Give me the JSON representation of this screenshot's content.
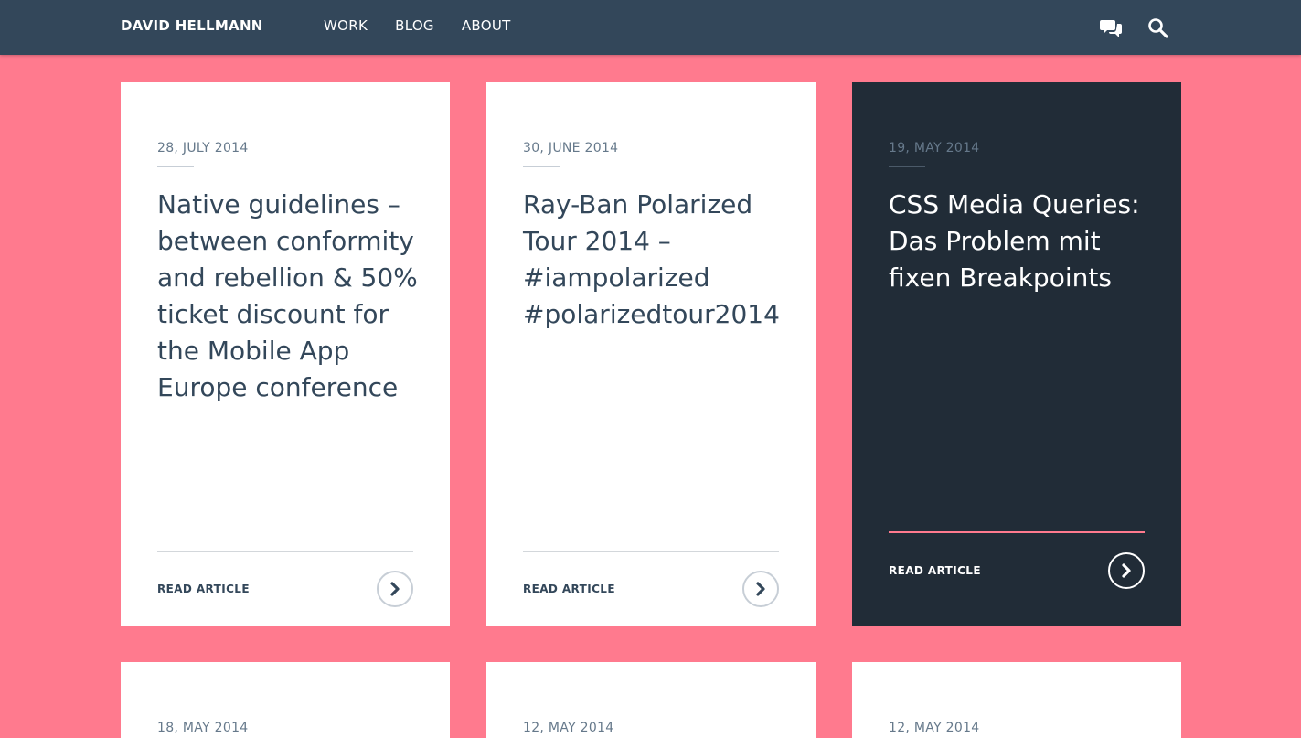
{
  "header": {
    "brand": "DAVID HELLMANN",
    "nav": [
      "WORK",
      "BLOG",
      "ABOUT"
    ],
    "icons": [
      "chat-icon",
      "search-icon"
    ],
    "background": "#33475a"
  },
  "colors": {
    "page_bg": "#ff7a8e",
    "dark_card": "#212c37",
    "text": "#33475a"
  },
  "cards": [
    {
      "date": "28, JULY 2014",
      "title": "Native guidelines – between conformity and rebellion & 50% ticket discount for the Mobile App Europe conference",
      "read": "READ ARTICLE"
    },
    {
      "date": "30, JUNE 2014",
      "title": "Ray-Ban Polarized Tour 2014 – #iampolarized #polarizedtour2014",
      "read": "READ ARTICLE"
    },
    {
      "date": "19, MAY 2014",
      "title": "CSS Media Queries: Das Problem mit fixen Breakpoints",
      "read": "READ ARTICLE"
    },
    {
      "date": "18, MAY 2014"
    },
    {
      "date": "12, MAY 2014"
    },
    {
      "date": "12, MAY 2014"
    }
  ]
}
